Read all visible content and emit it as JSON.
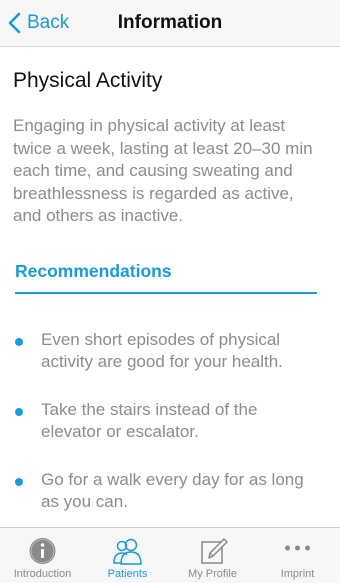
{
  "navbar": {
    "back_label": "Back",
    "title": "Information"
  },
  "content": {
    "title": "Physical Activity",
    "intro": "Engaging in physical activity at least twice a week, lasting at least 20–30 min each time, and causing sweating and breathlessness is regarded as active, and others as inactive.",
    "section_heading": "Recommendations",
    "recommendations": [
      "Even short episodes of physical activity are good for your health.",
      "Take the stairs instead of the elevator or escalator.",
      "Go for a walk every day for as long as you can."
    ]
  },
  "tabbar": {
    "tabs": [
      {
        "label": "Introduction",
        "icon": "info-icon",
        "active": false
      },
      {
        "label": "Patients",
        "icon": "patients-icon",
        "active": true
      },
      {
        "label": "My Profile",
        "icon": "edit-icon",
        "active": false
      },
      {
        "label": "Imprint",
        "icon": "more-icon",
        "active": false
      }
    ]
  },
  "colors": {
    "accent": "#1a9ad6",
    "body_text": "#8c8c8c",
    "title_text": "#111111",
    "bar_background": "#f7f7f7"
  }
}
